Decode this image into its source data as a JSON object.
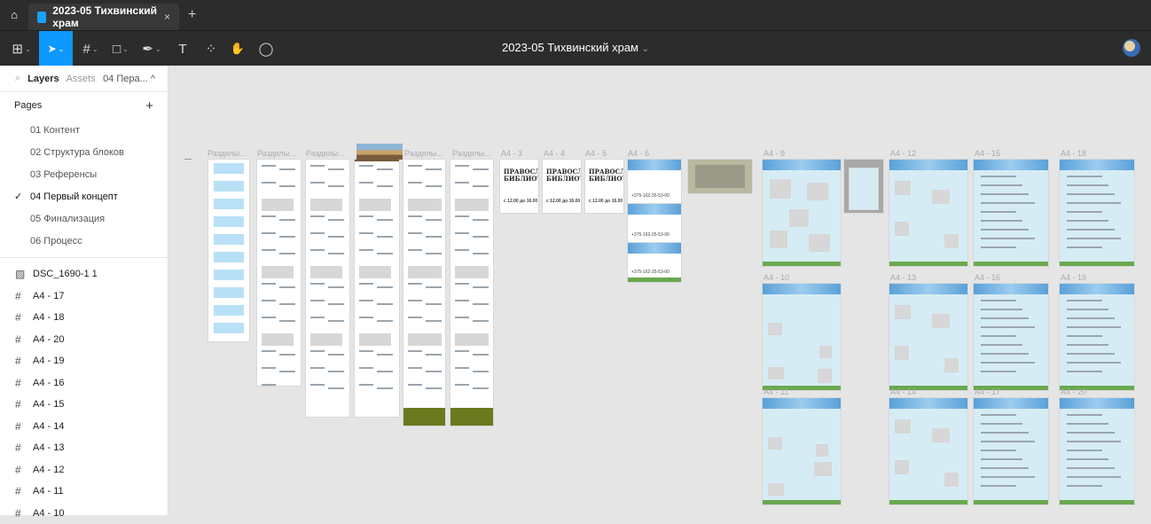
{
  "tab": {
    "title": "2023-05 Тихвинский храм",
    "close": "×",
    "new": "+"
  },
  "toolbar": {
    "doc_title": "2023-05 Тихвинский храм",
    "doc_caret": "⌄",
    "tools": [
      {
        "name": "main-menu-icon",
        "glyph": "⊞"
      },
      {
        "name": "move-tool-icon",
        "glyph": "➤"
      },
      {
        "name": "frame-tool-icon",
        "glyph": "#"
      },
      {
        "name": "shape-tool-icon",
        "glyph": "□"
      },
      {
        "name": "pen-tool-icon",
        "glyph": "✒"
      },
      {
        "name": "text-tool-icon",
        "glyph": "T"
      },
      {
        "name": "resources-icon",
        "glyph": "⁘"
      },
      {
        "name": "hand-tool-icon",
        "glyph": "✋"
      },
      {
        "name": "comment-tool-icon",
        "glyph": "◯"
      }
    ]
  },
  "sidebar": {
    "tab_layers": "Layers",
    "tab_assets": "Assets",
    "current_page": "04 Пера... ^",
    "pages_title": "Pages",
    "add": "+",
    "pages": [
      "01 Контент",
      "02 Структура блоков",
      "03 Референсы",
      "04 Первый концепт",
      "05 Финализация",
      "06 Процесс"
    ],
    "selected_page_index": 3,
    "layers": [
      {
        "icon": "image-icon",
        "glyph": "▨",
        "label": "DSC_1690-1 1"
      },
      {
        "icon": "frame-icon",
        "glyph": "#",
        "label": "A4 - 17"
      },
      {
        "icon": "frame-icon",
        "glyph": "#",
        "label": "A4 - 18"
      },
      {
        "icon": "frame-icon",
        "glyph": "#",
        "label": "A4 - 20"
      },
      {
        "icon": "frame-icon",
        "glyph": "#",
        "label": "A4 - 19"
      },
      {
        "icon": "frame-icon",
        "glyph": "#",
        "label": "A4 - 16"
      },
      {
        "icon": "frame-icon",
        "glyph": "#",
        "label": "A4 - 15"
      },
      {
        "icon": "frame-icon",
        "glyph": "#",
        "label": "A4 - 14"
      },
      {
        "icon": "frame-icon",
        "glyph": "#",
        "label": "A4 - 13"
      },
      {
        "icon": "frame-icon",
        "glyph": "#",
        "label": "A4 - 12"
      },
      {
        "icon": "frame-icon",
        "glyph": "#",
        "label": "A4 - 11"
      },
      {
        "icon": "frame-icon",
        "glyph": "#",
        "label": "A4 - 10"
      }
    ]
  },
  "canvas": {
    "section_labels": [
      "Разделы...",
      "Разделы...",
      "Разделы...",
      "Разделы...",
      "Разделы...",
      "Разделы..."
    ],
    "a4_labels": [
      "A4 - 3",
      "A4 - 4",
      "A4 - 5",
      "A4 - 6",
      "A4 - 9",
      "A4 - 12",
      "A4 - 15",
      "A4 - 18",
      "A4 - 10",
      "A4 - 13",
      "A4 - 16",
      "A4 - 19",
      "A4 - 11",
      "A4 - 14",
      "A4 - 17",
      "A4 - 20"
    ],
    "library_title": "ПРАВОСЛАВНАЯ БИБЛИОТЕКА",
    "library_hours": "с 12.00 до 16.00",
    "contacts": "Контакты",
    "phone": "+375-162-35-53-00",
    "questions": "Часто задаваемые вопросы",
    "site": "Сайт",
    "address": "Адрес"
  }
}
